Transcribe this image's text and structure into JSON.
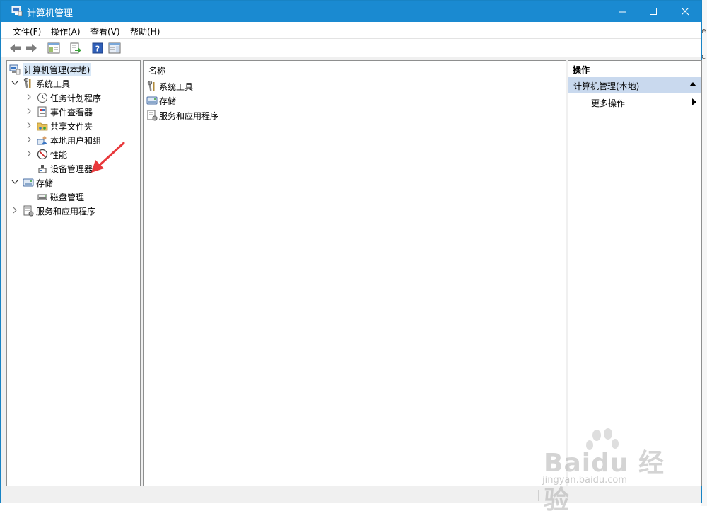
{
  "window": {
    "title": "计算机管理"
  },
  "menu": [
    "文件(F)",
    "操作(A)",
    "查看(V)",
    "帮助(H)"
  ],
  "toolbar": [
    "back-icon",
    "forward-icon",
    "show-hide-console-tree-icon",
    "export-list-icon",
    "help-icon",
    "action-pane-icon"
  ],
  "tree": {
    "root": "计算机管理(本地)",
    "system_tools": "系统工具",
    "task_scheduler": "任务计划程序",
    "event_viewer": "事件查看器",
    "shared_folders": "共享文件夹",
    "local_users": "本地用户和组",
    "performance": "性能",
    "device_manager": "设备管理器",
    "storage": "存储",
    "disk_management": "磁盘管理",
    "services_apps": "服务和应用程序"
  },
  "content": {
    "column_name": "名称",
    "items": [
      "系统工具",
      "存储",
      "服务和应用程序"
    ]
  },
  "actions": {
    "header": "操作",
    "section": "计算机管理(本地)",
    "more": "更多操作"
  },
  "watermark": {
    "brand": "Baidu 经验",
    "sub": "jingyan.baidu.com"
  },
  "colors": {
    "titlebar": "#1a8ad1",
    "selection": "#d9e8f7",
    "action_section": "#c9d9ee",
    "arrow": "#e8383b"
  }
}
